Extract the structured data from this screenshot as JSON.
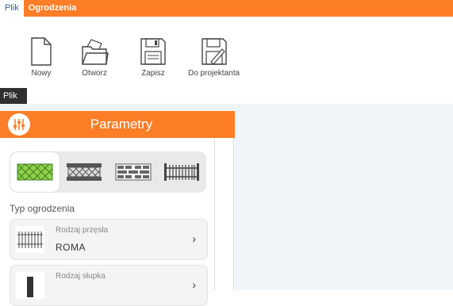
{
  "menubar": {
    "items": [
      "Plik",
      "Ogrodzenia"
    ]
  },
  "ribbon": {
    "buttons": [
      {
        "label": "Nowy",
        "icon": "new-file-icon"
      },
      {
        "label": "Otworz",
        "icon": "open-folder-icon"
      },
      {
        "label": "Zapisz",
        "icon": "save-disk-icon"
      },
      {
        "label": "Do projektanta",
        "icon": "export-designer-icon"
      }
    ],
    "group_label": "Plik"
  },
  "panel": {
    "title": "Parametry",
    "fence_types": [
      "lattice-fence-icon",
      "stone-fence-icon",
      "brick-fence-icon",
      "rail-fence-icon"
    ],
    "section_label": "Typ ogrodzenia",
    "cards": [
      {
        "caption": "Rodzaj przęsła",
        "value": "ROMA"
      },
      {
        "caption": "Rodzaj słupka",
        "value": ""
      }
    ]
  },
  "colors": {
    "accent": "#fd7e27",
    "workspace": "#eef4f7",
    "dark": "#2f2f2f"
  }
}
